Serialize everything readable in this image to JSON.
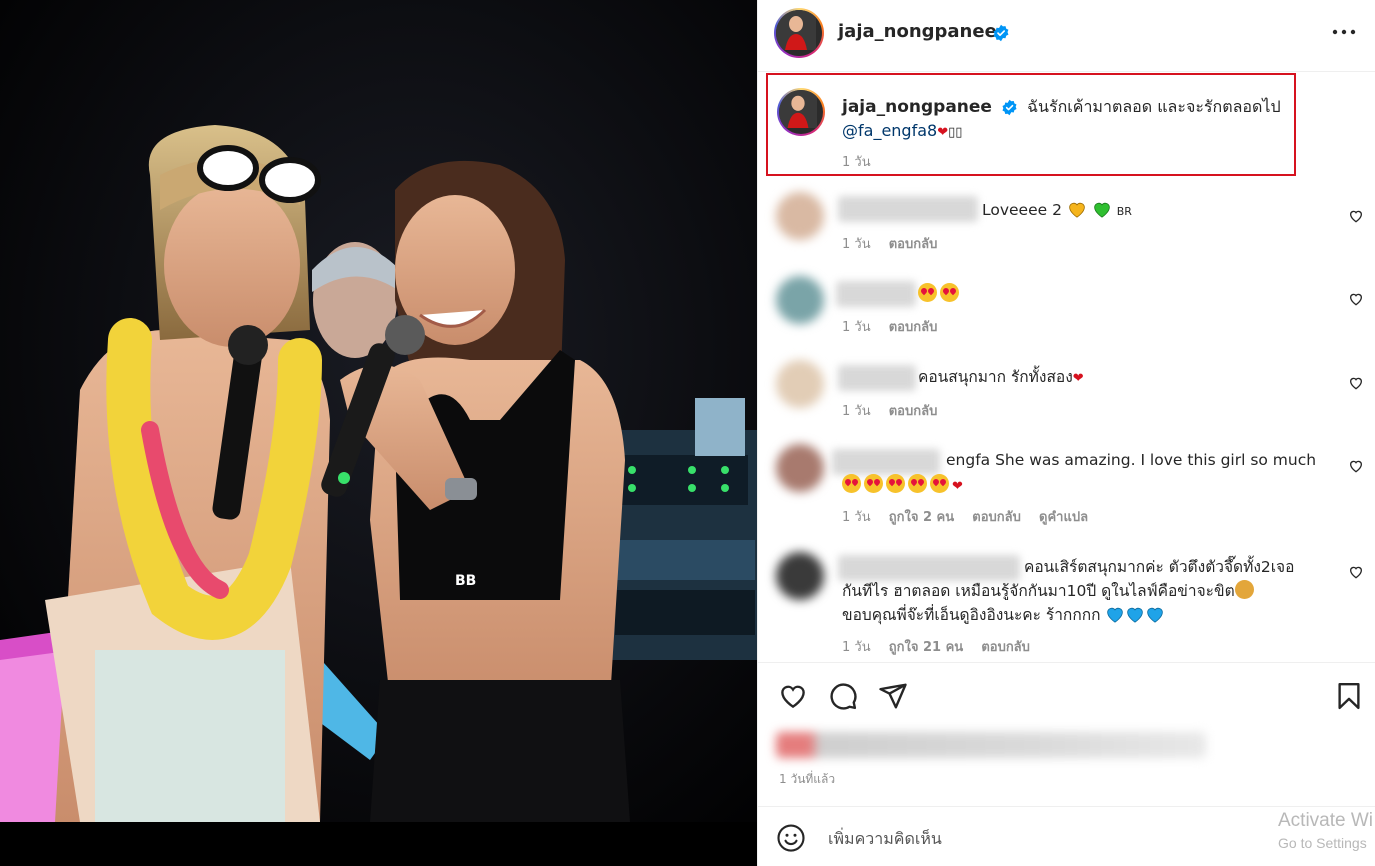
{
  "post": {
    "username": "jaja_nongpanee",
    "verified": true
  },
  "caption": {
    "username": "jaja_nongpanee",
    "text": "ฉันรักเค้ามาตลอด และจะรักตลอดไป",
    "mention": "@fa_engfa8",
    "time": "1 วัน"
  },
  "comments": [
    {
      "text": "Loveeee 2",
      "suffix": "BR",
      "time": "1 วัน",
      "reply": "ตอบกลับ",
      "likes": "",
      "translate": ""
    },
    {
      "text": "",
      "time": "1 วัน",
      "reply": "ตอบกลับ",
      "likes": "",
      "translate": ""
    },
    {
      "text": "คอนสนุกมาก รักทั้งสอง",
      "time": "1 วัน",
      "reply": "ตอบกลับ",
      "likes": "",
      "translate": ""
    },
    {
      "text": "engfa She was amazing. I love this girl so much",
      "time": "1 วัน",
      "likes": "ถูกใจ 2 คน",
      "reply": "ตอบกลับ",
      "translate": "ดูคำแปล"
    },
    {
      "line1": "คอนเสิร์ตสนุกมากค่ะ ตัวตึงตัวจึ๊ดทั้ง2เจอ",
      "line2": "กันทีไร ฮาตลอด เหมือนรู้จักกันมา10ปี ดูในไลฟ์คือข่าจะขิต",
      "line3": "ขอบคุณพี่จ๊ะที่เอ็นดูอิงอิงนะคะ ร้ากกกก",
      "time": "1 วัน",
      "likes": "ถูกใจ 21 คน",
      "reply": "ตอบกลับ",
      "translate": ""
    }
  ],
  "footer": {
    "posted_time": "1 วันที่แล้ว",
    "comment_placeholder": "เพิ่มความคิดเห็น"
  },
  "watermark": {
    "line1": "Activate Wi",
    "line2": "Go to Settings"
  },
  "icons": {
    "verified": "verified-badge-icon",
    "more": "more-options-icon",
    "like": "heart-icon",
    "comment": "comment-bubble-icon",
    "share": "paper-plane-icon",
    "save": "bookmark-icon",
    "emoji": "smiley-icon"
  },
  "colors": {
    "highlight_border": "#d6121f",
    "verified_blue": "#0095f6",
    "mention_blue": "#00376b",
    "secondary_text": "#8e8e8e"
  }
}
